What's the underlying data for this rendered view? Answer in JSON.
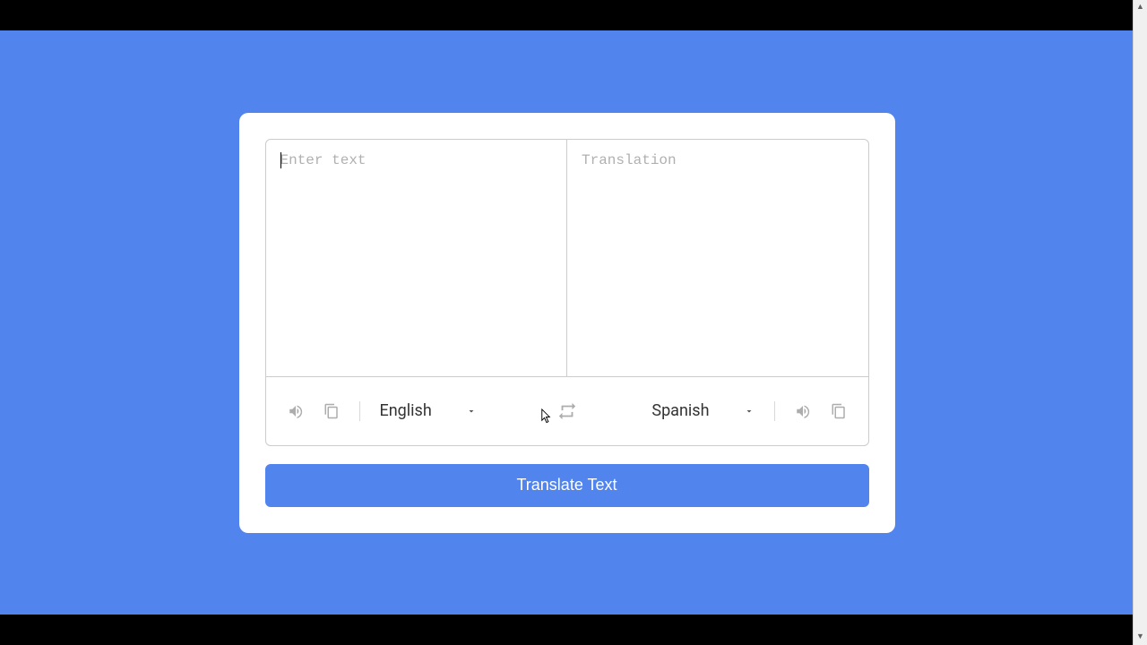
{
  "source": {
    "placeholder": "Enter text",
    "value": "",
    "language": "English"
  },
  "target": {
    "placeholder": "Translation",
    "value": "",
    "language": "Spanish"
  },
  "translate_button_label": "Translate Text"
}
